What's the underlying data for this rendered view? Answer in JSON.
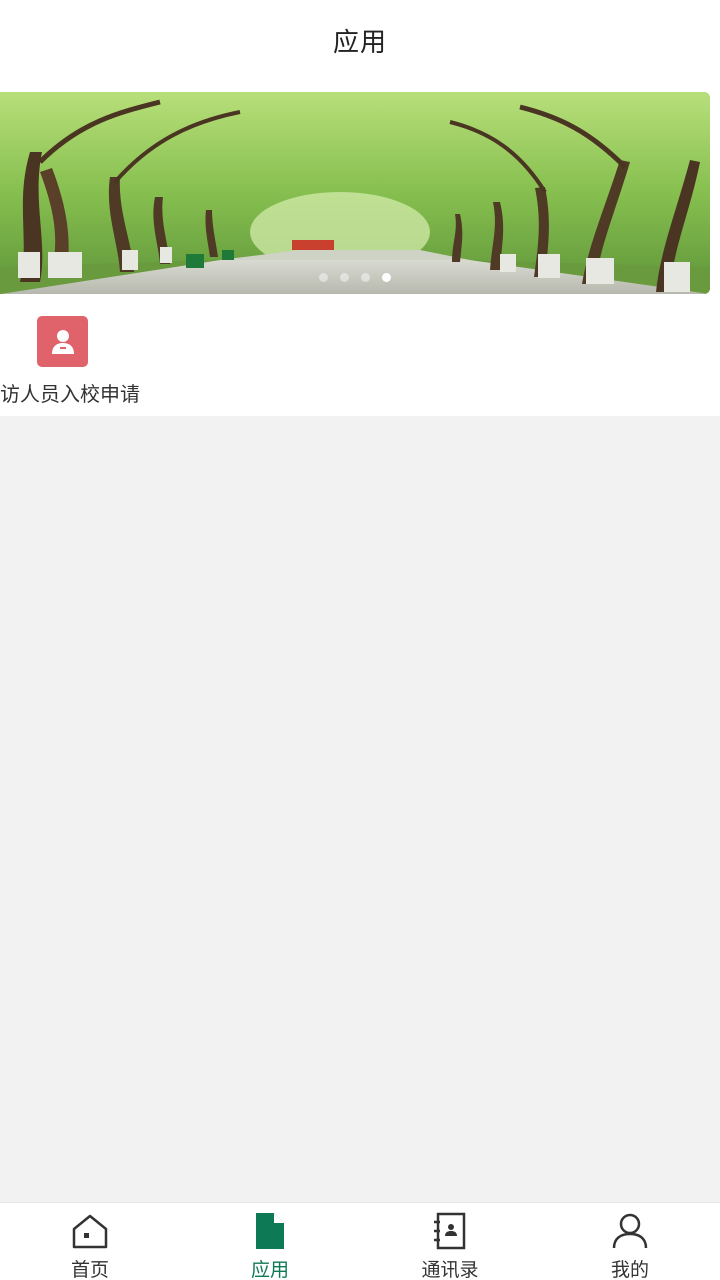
{
  "header": {
    "title": "应用"
  },
  "banner": {
    "slides_count": 4,
    "active_index": 3
  },
  "apps": [
    {
      "label": "访人员入校申请",
      "icon": "visitor-person-icon",
      "color": "#e0626b"
    }
  ],
  "tabbar": {
    "active_color": "#0e7a55",
    "items": [
      {
        "label": "首页",
        "icon": "home-icon"
      },
      {
        "label": "应用",
        "icon": "document-icon"
      },
      {
        "label": "通讯录",
        "icon": "contacts-book-icon"
      },
      {
        "label": "我的",
        "icon": "user-icon"
      }
    ]
  }
}
